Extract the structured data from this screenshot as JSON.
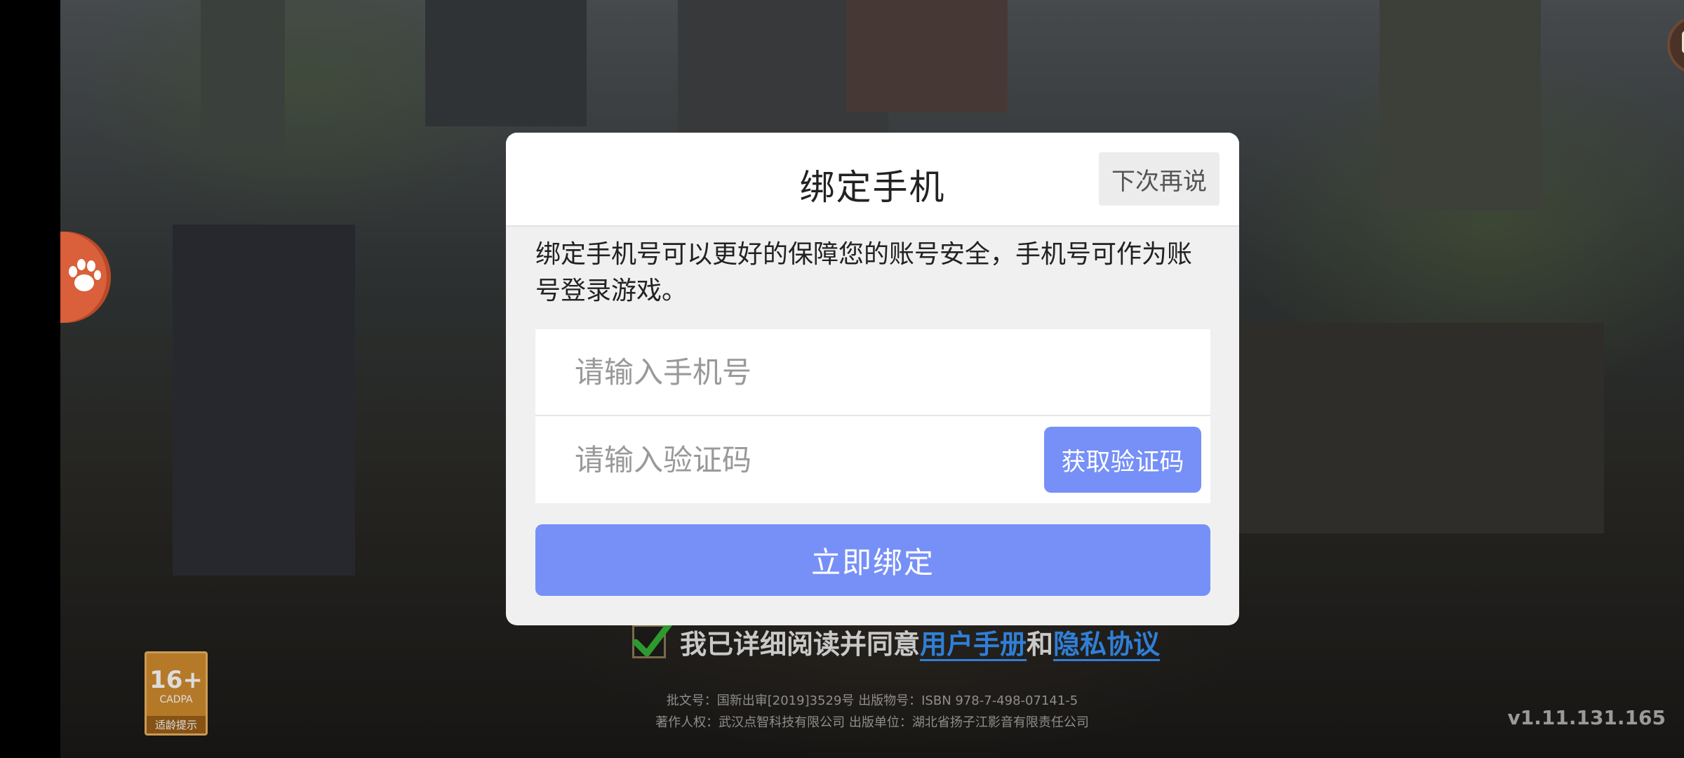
{
  "dialog": {
    "title": "绑定手机",
    "skip_label": "下次再说",
    "description": "绑定手机号可以更好的保障您的账号安全，手机号可作为账号登录游戏。",
    "phone_placeholder": "请输入手机号",
    "phone_value": "",
    "code_placeholder": "请输入验证码",
    "code_value": "",
    "get_code_label": "获取验证码",
    "bind_label": "立即绑定"
  },
  "consent": {
    "checked": true,
    "prefix": "我已详细阅读并同意",
    "user_manual": "用户手册",
    "conjunction": "和",
    "privacy": "隐私协议"
  },
  "legal": {
    "line1": "批文号：国新出审[2019]3529号 出版物号：ISBN 978-7-498-07141-5",
    "line2": "著作人权：武汉点智科技有限公司 出版单位：湖北省扬子江影音有限责任公司"
  },
  "age_rating": {
    "age": "16+",
    "org": "CADPA",
    "tip": "适龄提示"
  },
  "version": "v1.11.131.165",
  "colors": {
    "accent": "#7690f8",
    "link": "#2f7fd8",
    "paw_button": "#d9603a"
  }
}
